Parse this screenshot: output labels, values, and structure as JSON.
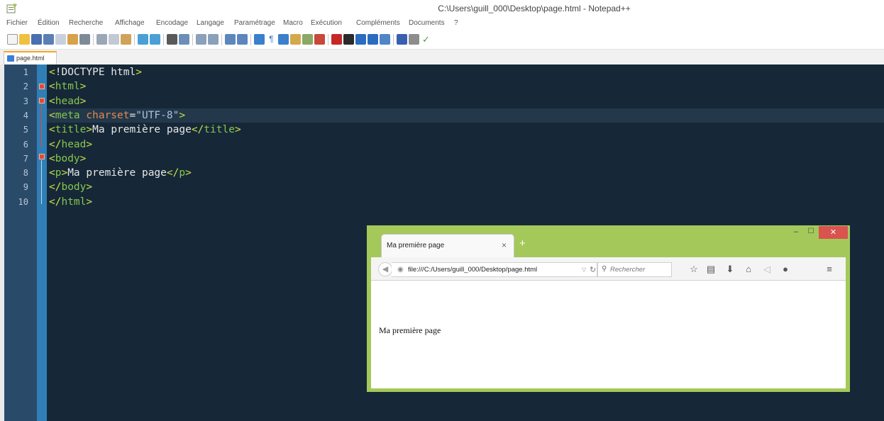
{
  "window": {
    "title": "C:\\Users\\guill_000\\Desktop\\page.html - Notepad++"
  },
  "menu": [
    "Fichier",
    "Édition",
    "Recherche",
    "Affichage",
    "Encodage",
    "Langage",
    "Paramétrage",
    "Macro",
    "Exécution",
    "Compléments",
    "Documents",
    "?"
  ],
  "tab": {
    "label": "page.html"
  },
  "editor": {
    "line_numbers": [
      "1",
      "2",
      "3",
      "4",
      "5",
      "6",
      "7",
      "8",
      "9",
      "10"
    ],
    "lines": [
      [
        {
          "t": "<",
          "c": "punc"
        },
        {
          "t": "!DOCTYPE html",
          "c": "text"
        },
        {
          "t": ">",
          "c": "punc"
        }
      ],
      [
        {
          "t": "<",
          "c": "punc"
        },
        {
          "t": "html",
          "c": "tag"
        },
        {
          "t": ">",
          "c": "punc"
        }
      ],
      [
        {
          "t": "<",
          "c": "punc"
        },
        {
          "t": "head",
          "c": "tag"
        },
        {
          "t": ">",
          "c": "punc"
        }
      ],
      [
        {
          "t": "<",
          "c": "punc"
        },
        {
          "t": "meta ",
          "c": "tag"
        },
        {
          "t": "charset",
          "c": "attr"
        },
        {
          "t": "=",
          "c": "text"
        },
        {
          "t": "\"UTF-8\"",
          "c": "str"
        },
        {
          "t": ">",
          "c": "punc"
        }
      ],
      [
        {
          "t": "<",
          "c": "punc"
        },
        {
          "t": "title",
          "c": "tag"
        },
        {
          "t": ">",
          "c": "punc"
        },
        {
          "t": "Ma première page",
          "c": "text"
        },
        {
          "t": "</",
          "c": "punc"
        },
        {
          "t": "title",
          "c": "tag"
        },
        {
          "t": ">",
          "c": "punc"
        }
      ],
      [
        {
          "t": "</",
          "c": "punc"
        },
        {
          "t": "head",
          "c": "tag"
        },
        {
          "t": ">",
          "c": "punc"
        }
      ],
      [
        {
          "t": "<",
          "c": "punc"
        },
        {
          "t": "body",
          "c": "tag"
        },
        {
          "t": ">",
          "c": "punc"
        }
      ],
      [
        {
          "t": "<",
          "c": "punc"
        },
        {
          "t": "p",
          "c": "tag"
        },
        {
          "t": ">",
          "c": "punc"
        },
        {
          "t": "Ma première page",
          "c": "text"
        },
        {
          "t": "</",
          "c": "punc"
        },
        {
          "t": "p",
          "c": "tag"
        },
        {
          "t": ">",
          "c": "punc"
        }
      ],
      [
        {
          "t": "</",
          "c": "punc"
        },
        {
          "t": "body",
          "c": "tag"
        },
        {
          "t": ">",
          "c": "punc"
        }
      ],
      [
        {
          "t": "</",
          "c": "punc"
        },
        {
          "t": "html",
          "c": "tag"
        },
        {
          "t": ">",
          "c": "punc"
        }
      ]
    ],
    "colors": {
      "background": "#162837",
      "tag": "#85c54f",
      "attr": "#e08a55",
      "string": "#a7c3e0",
      "punctuation": "#c8e04a"
    }
  },
  "browser": {
    "tab_title": "Ma première page",
    "tab_close": "×",
    "new_tab": "+",
    "url": "file:///C:/Users/guill_000/Desktop/page.html",
    "search_placeholder": "Rechercher",
    "body_text": "Ma première page",
    "frame_color": "#a4c95a",
    "icons": [
      "back-icon",
      "globe-icon",
      "reload-icon",
      "search-icon",
      "bookmark-star-icon",
      "reading-list-icon",
      "download-icon",
      "home-icon",
      "share-icon",
      "chat-icon",
      "hamburger-menu-icon"
    ]
  }
}
